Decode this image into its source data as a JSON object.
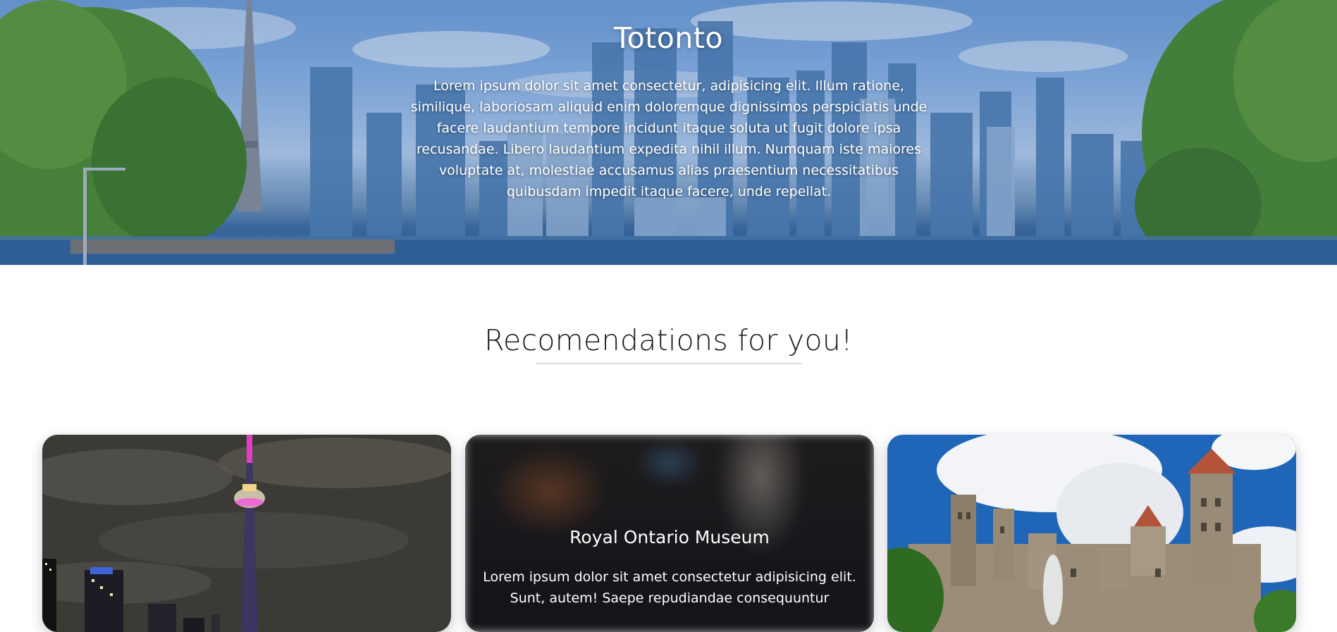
{
  "hero": {
    "title": "Totonto",
    "text": "Lorem ipsum dolor sit amet consectetur, adipisicing elit. Illum ratione, similique, laboriosam aliquid enim doloremque dignissimos perspiciatis unde facere laudantium tempore incidunt itaque soluta ut fugit dolore ipsa recusandae. Libero laudantium expedita nihil illum. Numquam iste maiores voluptate at, molestiae accusamus alias praesentium necessitatibus quibusdam impedit itaque facere, unde repellat."
  },
  "recommendations": {
    "title": "Recomendations for you!",
    "cards": [
      {
        "title": "",
        "text": ""
      },
      {
        "title": "Royal Ontario Museum",
        "text": "Lorem ipsum dolor sit amet consectetur adipisicing elit. Sunt, autem! Saepe repudiandae consequuntur"
      },
      {
        "title": "",
        "text": ""
      }
    ]
  },
  "colors": {
    "sky": "#8fb6e6",
    "water": "#2d5e95",
    "foliage": "#4f8a2a",
    "night_sky": "#3b3a35",
    "tower_light": "#e63cc8"
  }
}
